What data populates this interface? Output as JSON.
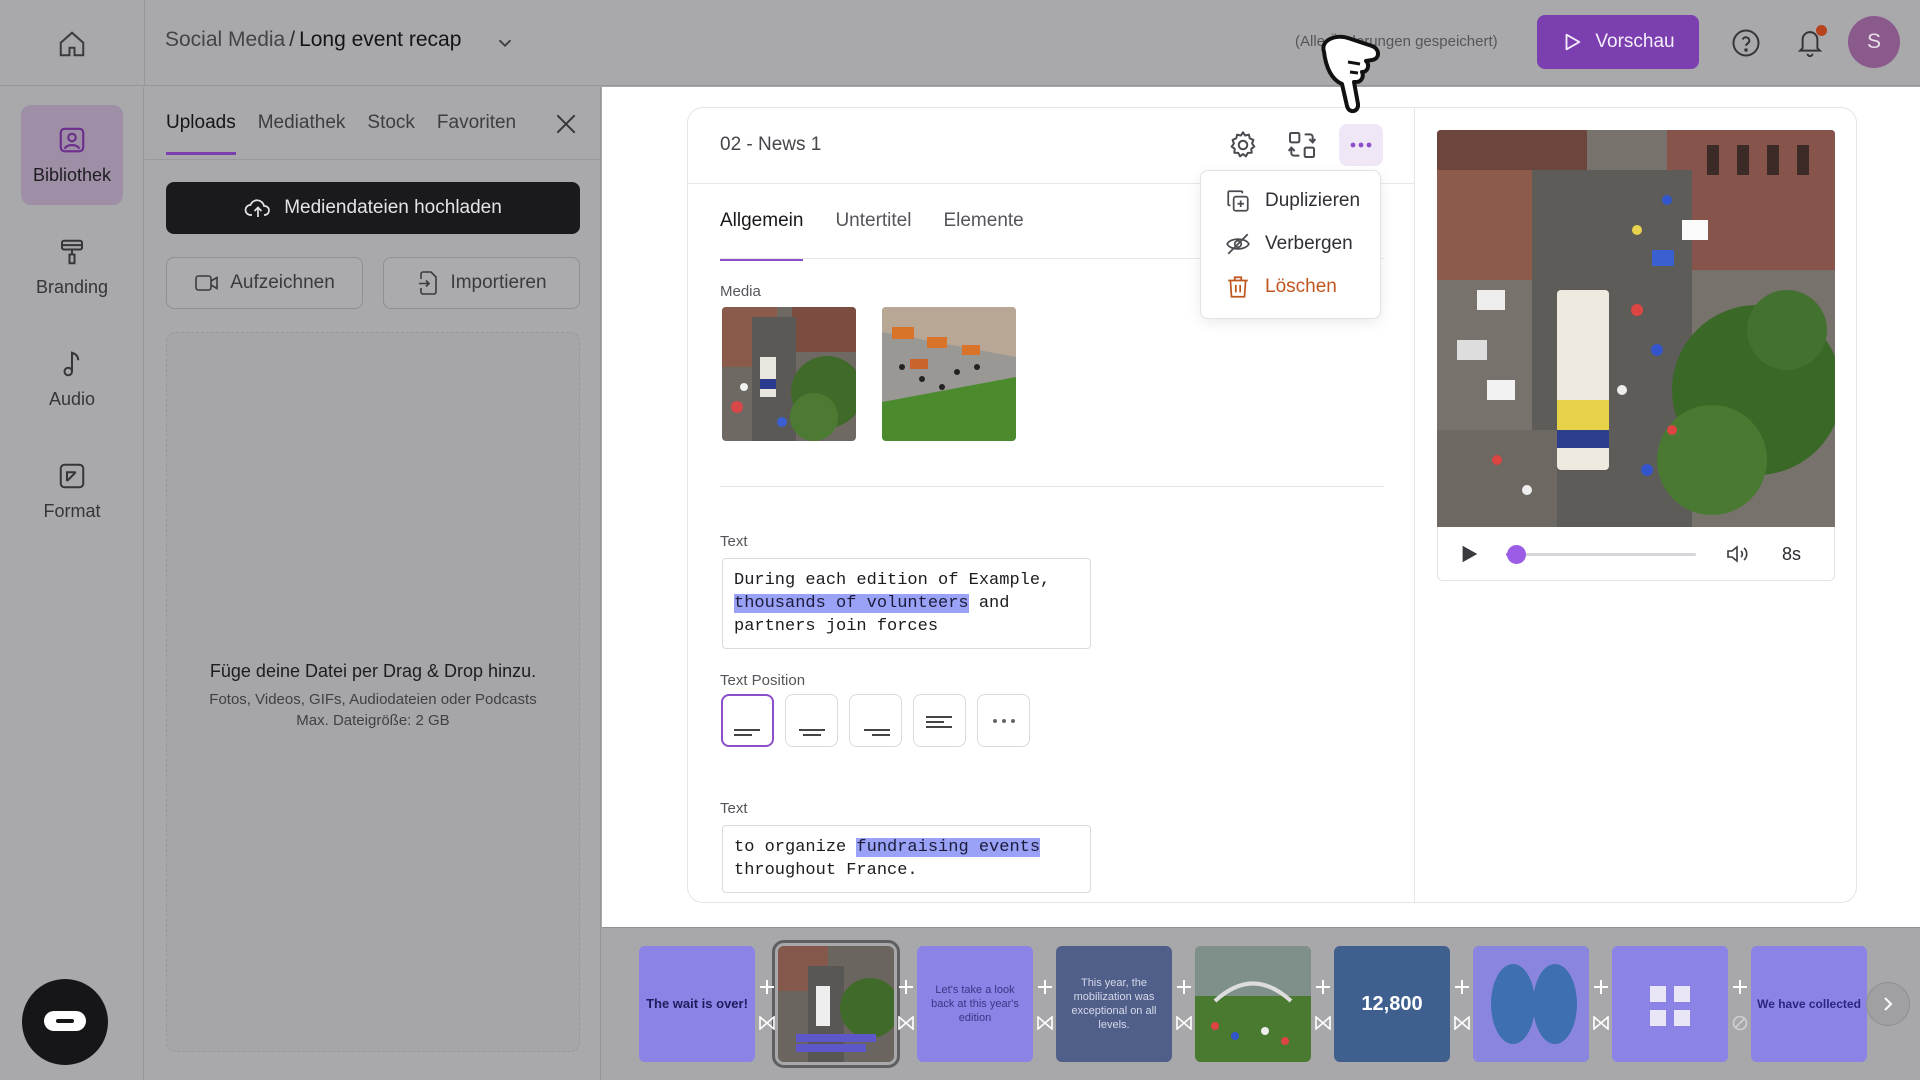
{
  "header": {
    "breadcrumb_parent": "Social Media",
    "breadcrumb_separator": "/",
    "breadcrumb_current": "Long event recap",
    "save_status": "(Alle Änderungen gespeichert)",
    "preview_label": "Vorschau",
    "avatar_initial": "S",
    "colors": {
      "accent": "#7c3fb0",
      "overlay": "#a9a9ac"
    }
  },
  "rail": {
    "items": [
      {
        "label": "Bibliothek",
        "icon": "image-icon",
        "active": true
      },
      {
        "label": "Branding",
        "icon": "paint-roller-icon"
      },
      {
        "label": "Audio",
        "icon": "music-note-icon"
      },
      {
        "label": "Format",
        "icon": "resize-icon"
      }
    ]
  },
  "library": {
    "tabs": [
      "Uploads",
      "Mediathek",
      "Stock",
      "Favoriten"
    ],
    "upload_label": "Mediendateien hochladen",
    "record_label": "Aufzeichnen",
    "import_label": "Importieren",
    "dropzone_title": "Füge deine Datei per Drag & Drop hinzu.",
    "dropzone_types": "Fotos, Videos, GIFs, Audiodateien oder Podcasts",
    "dropzone_limit": "Max. Dateigröße: 2 GB"
  },
  "editor": {
    "scene_title": "02 - News 1",
    "tabs": [
      "Allgemein",
      "Untertitel",
      "Elemente"
    ],
    "media_label": "Media",
    "text1_label": "Text",
    "text1_before": "During each edition of Example,",
    "text1_highlight": "thousands of volunteers",
    "text1_after": "and partners join forces",
    "position_label": "Text Position",
    "text2_label": "Text",
    "text2_before": "to organize",
    "text2_highlight": "fundraising events",
    "text2_after": "throughout France."
  },
  "menu": {
    "items": [
      {
        "label": "Duplizieren",
        "icon": "duplicate-icon"
      },
      {
        "label": "Verbergen",
        "icon": "eye-off-icon"
      },
      {
        "label": "Löschen",
        "icon": "trash-icon",
        "danger": true
      }
    ]
  },
  "player": {
    "duration": "8s",
    "progress": 0.05
  },
  "timeline": {
    "scenes": [
      {
        "text": "The wait is over!"
      },
      {
        "text": ""
      },
      {
        "text": "Let's take a look back at this year's edition"
      },
      {
        "text": "This year, the mobilization was exceptional on all levels."
      },
      {
        "text": ""
      },
      {
        "text": "12,800"
      },
      {
        "text": ""
      },
      {
        "text": ""
      },
      {
        "text": "We have collected"
      }
    ]
  }
}
